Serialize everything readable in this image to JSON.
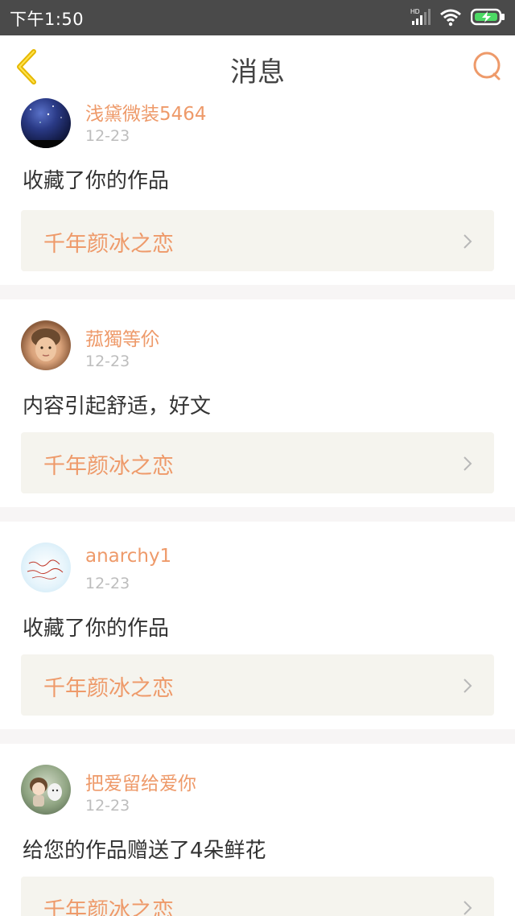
{
  "status_bar": {
    "time": "下午1:50",
    "network_label": "HD"
  },
  "header": {
    "title": "消息"
  },
  "colors": {
    "accent": "#ee9a6a",
    "back_arrow": "#e6b800",
    "card_link_bg": "#f5f4ee",
    "divider": "#f7f5f5"
  },
  "notifications": [
    {
      "username": "浅黛微装5464",
      "date": "12-23",
      "message": "收藏了你的作品",
      "work_title": "千年颜冰之恋",
      "avatar": "night-sky-avatar"
    },
    {
      "username": "菰獨等伱",
      "date": "12-23",
      "message": "内容引起舒适，好文",
      "work_title": "千年颜冰之恋",
      "avatar": "child-portrait-avatar"
    },
    {
      "username": "anarchy1",
      "date": "12-23",
      "message": "收藏了你的作品",
      "work_title": "千年颜冰之恋",
      "avatar": "handwriting-avatar"
    },
    {
      "username": "把爱留给爱你",
      "date": "12-23",
      "message": "给您的作品赠送了4朵鲜花",
      "work_title": "千年颜冰之恋",
      "avatar": "figurine-avatar"
    }
  ]
}
